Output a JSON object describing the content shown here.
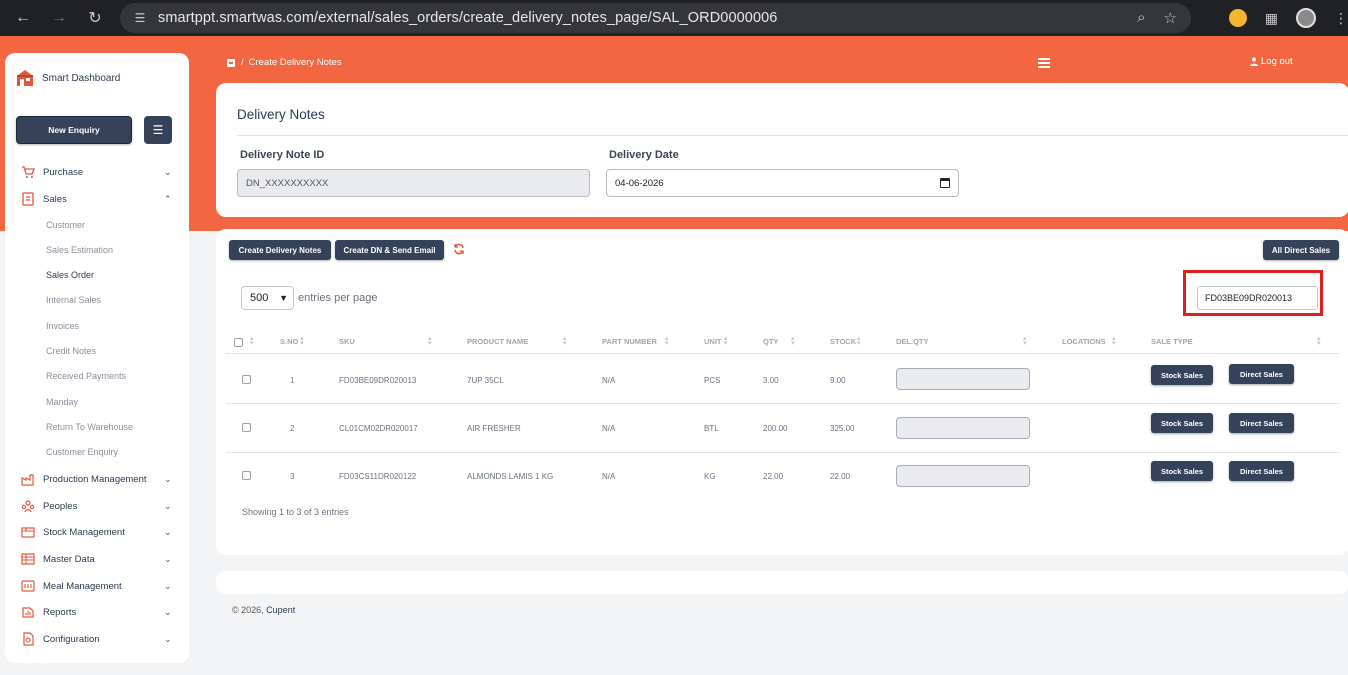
{
  "browser": {
    "url": "smartppt.smartwas.com/external/sales_orders/create_delivery_notes_page/SAL_ORD0000006"
  },
  "sidebar": {
    "brand": "Smart Dashboard",
    "new_enquiry": "New Enquiry",
    "menu": [
      {
        "label": "Purchase",
        "icon": "cart-icon"
      },
      {
        "label": "Sales",
        "icon": "sales-icon"
      },
      {
        "label": "Production Management",
        "icon": "factory-icon"
      },
      {
        "label": "Peoples",
        "icon": "people-icon"
      },
      {
        "label": "Stock Management",
        "icon": "stock-icon"
      },
      {
        "label": "Master Data",
        "icon": "data-icon"
      },
      {
        "label": "Meal Management",
        "icon": "meal-icon"
      },
      {
        "label": "Reports",
        "icon": "reports-icon"
      },
      {
        "label": "Configuration",
        "icon": "config-icon"
      }
    ],
    "sales_sub": [
      "Customer",
      "Sales Estimation",
      "Sales Order",
      "Internal Sales",
      "Invoices",
      "Credit Notes",
      "Received Payments",
      "Manday",
      "Return To Warehouse",
      "Customer Enquiry"
    ],
    "active_sub": "Sales Order"
  },
  "header": {
    "breadcrumb_sep": "/",
    "breadcrumb": "Create Delivery Notes",
    "logout": "Log out"
  },
  "form": {
    "title": "Delivery Notes",
    "id_label": "Delivery Note ID",
    "id_value": "DN_XXXXXXXXXX",
    "date_label": "Delivery Date",
    "date_value": "04-06-2026"
  },
  "toolbar": {
    "create_dn": "Create Delivery Notes",
    "create_send": "Create DN & Send Email",
    "all_direct": "All Direct Sales"
  },
  "table_controls": {
    "entries_value": "500",
    "entries_label": "entries per page",
    "search_value": "FD03BE09DR020013"
  },
  "table": {
    "headers": [
      "S.NO",
      "SKU",
      "PRODUCT NAME",
      "PART NUMBER",
      "UNIT",
      "QTY",
      "STOCK",
      "DEL.QTY",
      "LOCATIONS",
      "SALE TYPE"
    ],
    "rows": [
      {
        "sno": "1",
        "sku": "FD03BE09DR020013",
        "product": "7UP 35CL",
        "part": "N/A",
        "unit": "PCS",
        "qty": "3.00",
        "stock": "9.00"
      },
      {
        "sno": "2",
        "sku": "CL01CM02DR020017",
        "product": "AIR FRESHER",
        "part": "N/A",
        "unit": "BTL",
        "qty": "200.00",
        "stock": "325.00"
      },
      {
        "sno": "3",
        "sku": "FD03CS11DR020122",
        "product": "ALMONDS LAMIS 1 KG",
        "part": "N/A",
        "unit": "KG",
        "qty": "22.00",
        "stock": "22.00"
      }
    ],
    "stock_sales": "Stock Sales",
    "direct_sales": "Direct Sales",
    "showing": "Showing 1 to 3 of 3 entries"
  },
  "footer": {
    "copyright": "© 2026,",
    "company": "Cupent"
  }
}
